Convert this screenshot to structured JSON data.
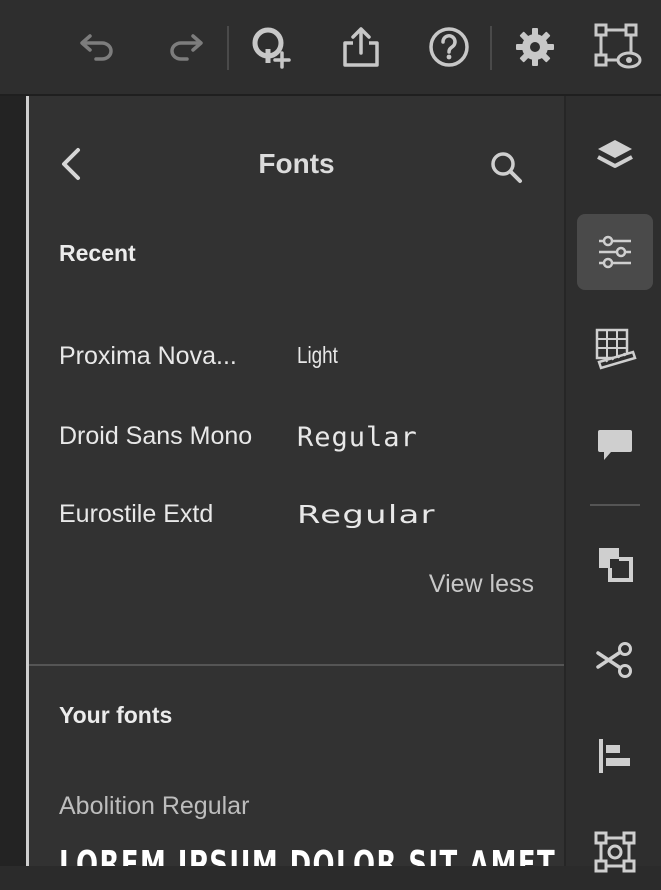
{
  "toolbar": {
    "icons": [
      "undo-icon",
      "redo-icon",
      "invite-icon",
      "share-icon",
      "help-icon",
      "gear-icon",
      "preview-icon"
    ]
  },
  "panel": {
    "title": "Fonts",
    "recent_title": "Recent",
    "recent": [
      {
        "name": "Proxima Nova...",
        "style": "Light"
      },
      {
        "name": "Droid Sans Mono",
        "style": "Regular"
      },
      {
        "name": "Eurostile Extd",
        "style": "Regular"
      }
    ],
    "view_less": "View less",
    "your_fonts_title": "Your fonts",
    "your_fonts": [
      {
        "name": "Abolition Regular",
        "preview": "LOREM IPSUM DOLOR SIT AMET, CONSEC"
      }
    ]
  },
  "rail": {
    "icons": [
      "layers-icon",
      "properties-icon",
      "grid-icon",
      "comment-icon",
      "arrange-icon",
      "scissors-icon",
      "align-icon",
      "transform-icon"
    ],
    "active": "properties-icon"
  },
  "colors": {
    "background": "#2b2b2b",
    "panel": "#323232",
    "text": "#e6e6e6",
    "icon": "#c8c8c8",
    "active": "#4a4a4a"
  }
}
